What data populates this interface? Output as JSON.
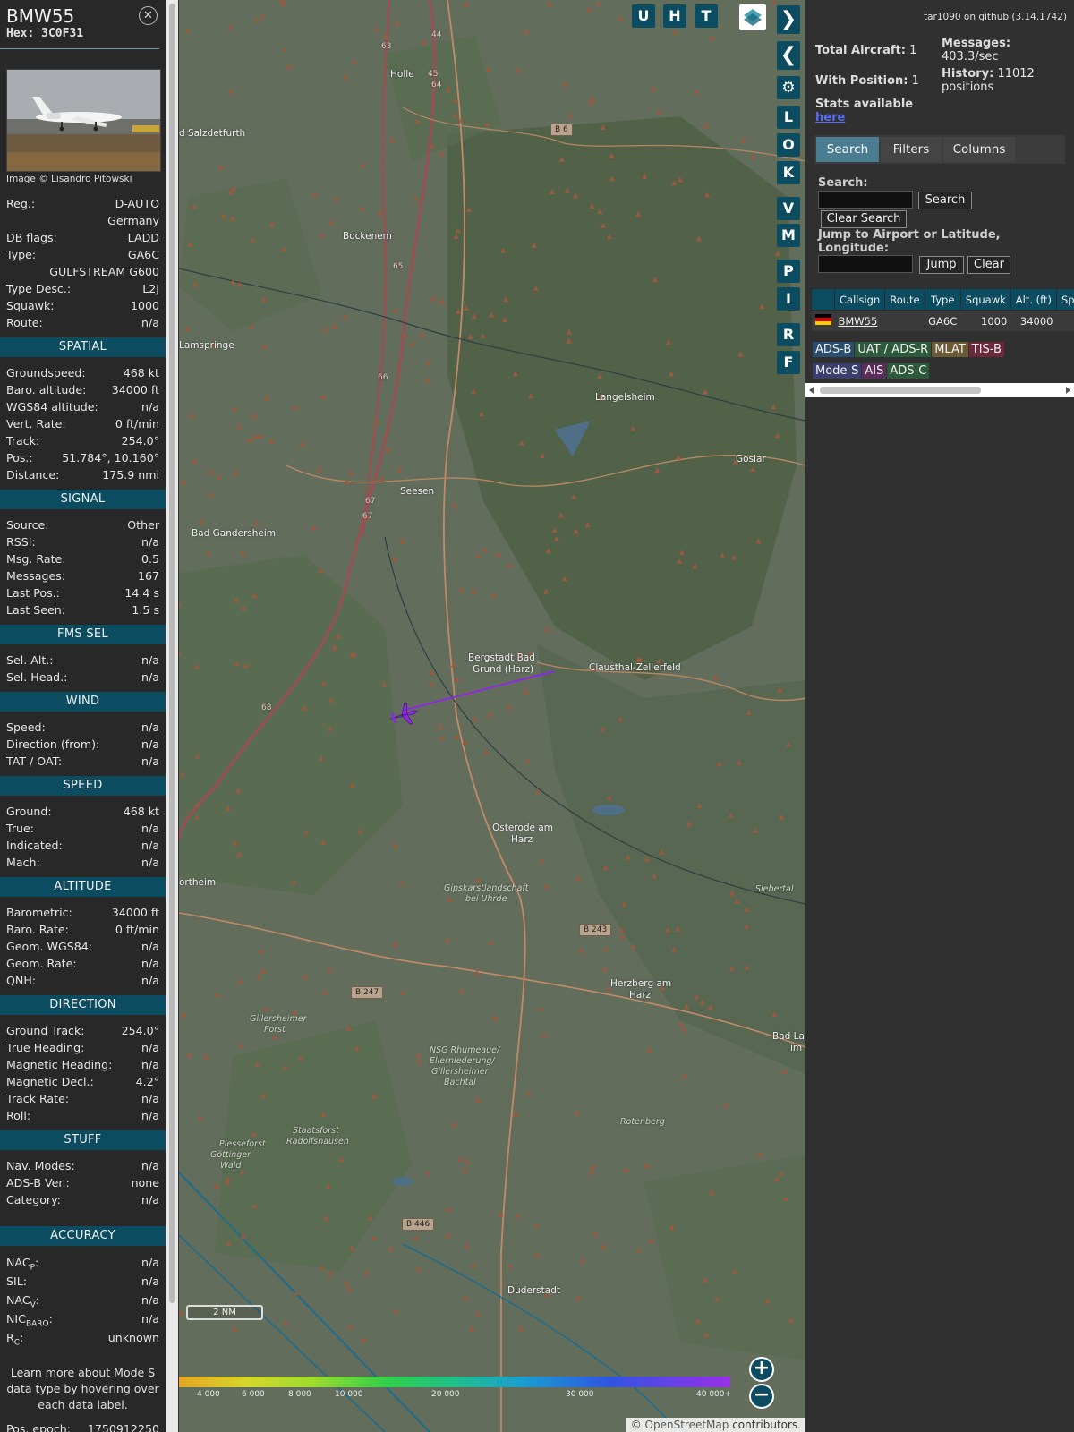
{
  "info": {
    "callsign": "BMW55",
    "hex_label": "Hex: 3C0F31",
    "photo_credit": "Image © Lisandro Pitowski",
    "general": [
      {
        "label": "Reg.:",
        "value": "D-AUTO",
        "link": true
      },
      {
        "label": "",
        "value": "Germany"
      },
      {
        "label": "DB flags:",
        "value": "LADD",
        "link": true
      },
      {
        "label": "Type:",
        "value": "GA6C"
      },
      {
        "label": "",
        "value": "GULFSTREAM G600"
      },
      {
        "label": "Type Desc.:",
        "value": "L2J"
      },
      {
        "label": "Squawk:",
        "value": "1000"
      },
      {
        "label": "Route:",
        "value": "n/a"
      }
    ],
    "sections": [
      {
        "title": "SPATIAL",
        "rows": [
          {
            "label": "Groundspeed:",
            "value": "468 kt"
          },
          {
            "label": "Baro. altitude:",
            "value": "34000 ft"
          },
          {
            "label": "WGS84 altitude:",
            "value": "n/a"
          },
          {
            "label": "Vert. Rate:",
            "value": "0 ft/min"
          },
          {
            "label": "Track:",
            "value": "254.0°"
          },
          {
            "label": "Pos.:",
            "value": "51.784°, 10.160°"
          },
          {
            "label": "Distance:",
            "value": "175.9 nmi"
          }
        ]
      },
      {
        "title": "SIGNAL",
        "rows": [
          {
            "label": "Source:",
            "value": "Other"
          },
          {
            "label": "RSSI:",
            "value": "n/a"
          },
          {
            "label": "Msg. Rate:",
            "value": "0.5"
          },
          {
            "label": "Messages:",
            "value": "167"
          },
          {
            "label": "Last Pos.:",
            "value": "14.4 s"
          },
          {
            "label": "Last Seen:",
            "value": "1.5 s"
          }
        ]
      },
      {
        "title": "FMS SEL",
        "rows": [
          {
            "label": "Sel. Alt.:",
            "value": "n/a"
          },
          {
            "label": "Sel. Head.:",
            "value": "n/a"
          }
        ]
      },
      {
        "title": "WIND",
        "rows": [
          {
            "label": "Speed:",
            "value": "n/a"
          },
          {
            "label": "Direction (from):",
            "value": "n/a"
          },
          {
            "label": "TAT / OAT:",
            "value": "n/a"
          }
        ]
      },
      {
        "title": "SPEED",
        "rows": [
          {
            "label": "Ground:",
            "value": "468 kt"
          },
          {
            "label": "True:",
            "value": "n/a"
          },
          {
            "label": "Indicated:",
            "value": "n/a"
          },
          {
            "label": "Mach:",
            "value": "n/a"
          }
        ]
      },
      {
        "title": "ALTITUDE",
        "rows": [
          {
            "label": "Barometric:",
            "value": "34000 ft"
          },
          {
            "label": "Baro. Rate:",
            "value": "0 ft/min"
          },
          {
            "label": "Geom. WGS84:",
            "value": "n/a"
          },
          {
            "label": "Geom. Rate:",
            "value": "n/a"
          },
          {
            "label": "QNH:",
            "value": "n/a"
          }
        ]
      },
      {
        "title": "DIRECTION",
        "rows": [
          {
            "label": "Ground Track:",
            "value": "254.0°"
          },
          {
            "label": "True Heading:",
            "value": "n/a"
          },
          {
            "label": "Magnetic Heading:",
            "value": "n/a"
          },
          {
            "label": "Magnetic Decl.:",
            "value": "4.2°"
          },
          {
            "label": "Track Rate:",
            "value": "n/a"
          },
          {
            "label": "Roll:",
            "value": "n/a"
          }
        ]
      },
      {
        "title": "STUFF",
        "rows": [
          {
            "label": "Nav. Modes:",
            "value": "n/a"
          },
          {
            "label": "ADS-B Ver.:",
            "value": "none"
          },
          {
            "label": "Category:",
            "value": "n/a"
          }
        ]
      }
    ],
    "accuracy": {
      "title": "ACCURACY",
      "rows": [
        {
          "label": "NAC",
          "sub": "P",
          "value": "n/a"
        },
        {
          "label": "SIL:",
          "sub": "",
          "value": "n/a"
        },
        {
          "label": "NAC",
          "sub": "V",
          "value": "n/a"
        },
        {
          "label": "NIC",
          "sub": "BARO",
          "value": "n/a"
        },
        {
          "label": "R",
          "sub": "C",
          "value": "unknown"
        }
      ]
    },
    "learn_more": "Learn more about Mode S data type by hovering over each data label.",
    "pos_epoch_label": "Pos. epoch:",
    "pos_epoch_value": "1750912250"
  },
  "map": {
    "top_buttons": [
      "U",
      "H",
      "T"
    ],
    "side_buttons": [
      "L",
      "O",
      "K",
      "V",
      "M",
      "P",
      "I",
      "R",
      "F"
    ],
    "labels": [
      {
        "id": "holle",
        "text": "Holle"
      },
      {
        "id": "salzdetfurth",
        "text": "d Salzdetfurth"
      },
      {
        "id": "bockenem",
        "text": "Bockenem"
      },
      {
        "id": "lamspringe",
        "text": "Lamspringe"
      },
      {
        "id": "langelsheim",
        "text": "Langelsheim"
      },
      {
        "id": "goslar",
        "text": "Goslar"
      },
      {
        "id": "seesen",
        "text": "Seesen"
      },
      {
        "id": "bad-gandersheim",
        "text": "Bad Gandersheim"
      },
      {
        "id": "bergstadt",
        "text": "Bergstadt Bad"
      },
      {
        "id": "bergstadt2",
        "text": "Grund (Harz)"
      },
      {
        "id": "clausthal",
        "text": "Clausthal-Zellerfeld"
      },
      {
        "id": "osterode",
        "text": "Osterode am"
      },
      {
        "id": "osterode2",
        "text": "Harz"
      },
      {
        "id": "northeim",
        "text": "ortheim"
      },
      {
        "id": "herzberg",
        "text": "Herzberg am"
      },
      {
        "id": "herzberg2",
        "text": "Harz"
      },
      {
        "id": "duderstadt",
        "text": "Duderstadt"
      },
      {
        "id": "badlau",
        "text": "Bad Lau"
      },
      {
        "id": "badlau2",
        "text": "im"
      },
      {
        "id": "siebertal",
        "text": "Siebertal"
      },
      {
        "id": "gipskarst",
        "text": "Gipskarstlandschaft"
      },
      {
        "id": "gipskarst2",
        "text": "bei Uhrde"
      },
      {
        "id": "gillersheimer",
        "text": "Gillersheimer"
      },
      {
        "id": "gillersheimer2",
        "text": "Forst"
      },
      {
        "id": "nsg",
        "text": "NSG Rhumeaue/"
      },
      {
        "id": "nsg2",
        "text": "Ellerniederung/"
      },
      {
        "id": "nsg3",
        "text": "Gillersheimer"
      },
      {
        "id": "nsg4",
        "text": "Bachtal"
      },
      {
        "id": "rotenberg",
        "text": "Rotenberg"
      },
      {
        "id": "staatsforst",
        "text": "Staatsforst"
      },
      {
        "id": "staatsforst2",
        "text": "Radolfshausen"
      },
      {
        "id": "plesseforst",
        "text": "Plesseforst"
      },
      {
        "id": "plesseforst2",
        "text": "Göttinger"
      },
      {
        "id": "plesseforst3",
        "text": "Wald"
      }
    ],
    "road_badges": [
      {
        "id": "b6",
        "text": "B 6"
      },
      {
        "id": "b243",
        "text": "B 243"
      },
      {
        "id": "b247",
        "text": "B 247"
      },
      {
        "id": "b446",
        "text": "B 446"
      }
    ],
    "road_numbers": [
      "63",
      "44",
      "45",
      "64",
      "65",
      "66",
      "67",
      "67",
      "68"
    ],
    "scale_label": "2 NM",
    "altitude_legend": [
      "4 000",
      "6 000",
      "8 000",
      "10 000",
      "20 000",
      "30 000",
      "40 000+"
    ],
    "attribution_prefix": "© ",
    "attribution_link": "OpenStreetMap",
    "attribution_suffix": " contributors.",
    "aircraft_color": "#8a2be2"
  },
  "right": {
    "github_link": "tar1090 on github (3.14.1742)",
    "total_aircraft_label": "Total Aircraft:",
    "total_aircraft_value": "1",
    "with_position_label": "With Position:",
    "with_position_value": "1",
    "messages_label": "Messages:",
    "messages_value": "403.3/sec",
    "history_label": "History:",
    "history_value": "11012",
    "history_unit": "positions",
    "stats_text": "Stats available",
    "stats_link": "here",
    "tabs": [
      "Search",
      "Filters",
      "Columns"
    ],
    "search_label": "Search:",
    "search_button": "Search",
    "clear_search_button": "Clear Search",
    "jump_label_1": "Jump to Airport or Latitude,",
    "jump_label_2": "Longitude:",
    "jump_button": "Jump",
    "clear_button": "Clear",
    "table_headers": [
      "Callsign",
      "Route",
      "Type",
      "Squawk",
      "Alt. (ft)",
      "Spd."
    ],
    "table_rows": [
      {
        "callsign": "BMW55",
        "route": "",
        "type": "GA6C",
        "squawk": "1000",
        "alt": "34000",
        "spd": ""
      }
    ],
    "badges": [
      {
        "text": "ADS-B",
        "color": "#2b4d6e"
      },
      {
        "text": "UAT / ADS-R",
        "color": "#2e5a3c"
      },
      {
        "text": "MLAT",
        "color": "#6b5a36"
      },
      {
        "text": "TIS-B",
        "color": "#6b2a3c"
      },
      {
        "text": "Mode-S",
        "color": "#3a3f6e"
      },
      {
        "text": "AIS",
        "color": "#5a2d5a"
      },
      {
        "text": "ADS-C",
        "color": "#2e5a3c"
      }
    ]
  }
}
